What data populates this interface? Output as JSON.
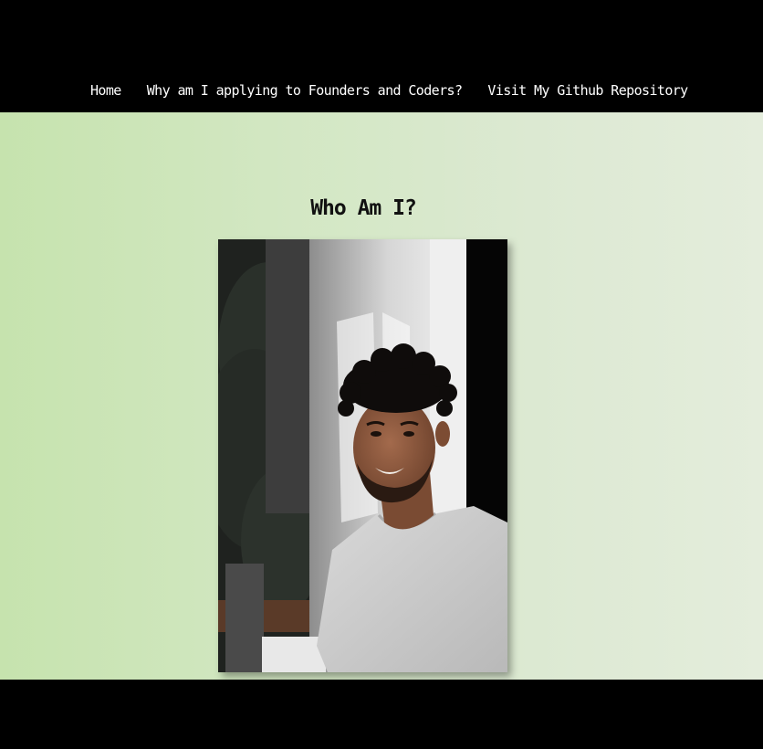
{
  "nav": {
    "items": [
      {
        "label": "Home"
      },
      {
        "label": "Why am I applying to Founders and Coders?"
      },
      {
        "label": "Visit My Github Repository"
      }
    ]
  },
  "main": {
    "title": "Who Am I?"
  },
  "colors": {
    "header_bg": "#000000",
    "gradient_left": "#c6e3ae",
    "gradient_right": "#e4eddc"
  }
}
